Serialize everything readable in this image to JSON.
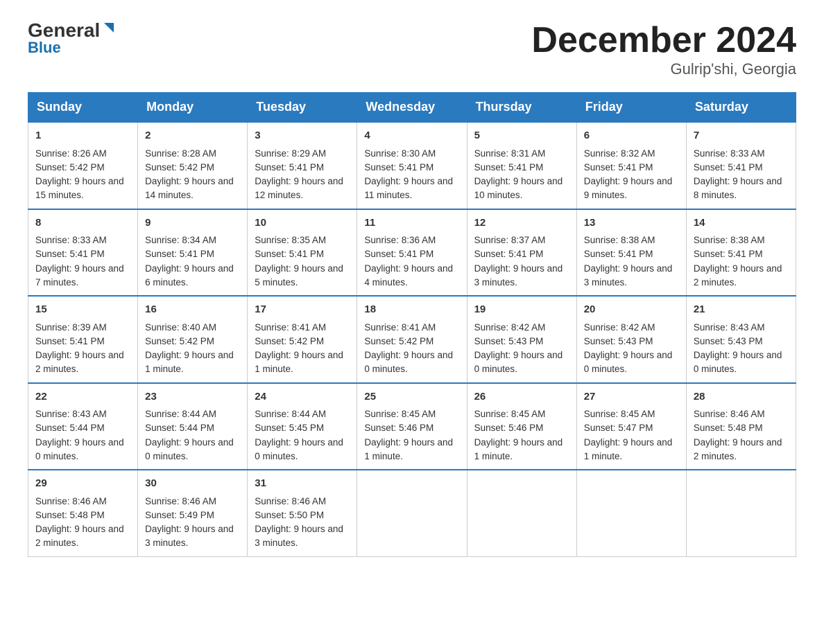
{
  "logo": {
    "general": "General",
    "blue": "Blue"
  },
  "title": "December 2024",
  "location": "Gulrip'shi, Georgia",
  "days_of_week": [
    "Sunday",
    "Monday",
    "Tuesday",
    "Wednesday",
    "Thursday",
    "Friday",
    "Saturday"
  ],
  "weeks": [
    [
      {
        "day": "1",
        "sunrise": "8:26 AM",
        "sunset": "5:42 PM",
        "daylight": "9 hours and 15 minutes."
      },
      {
        "day": "2",
        "sunrise": "8:28 AM",
        "sunset": "5:42 PM",
        "daylight": "9 hours and 14 minutes."
      },
      {
        "day": "3",
        "sunrise": "8:29 AM",
        "sunset": "5:41 PM",
        "daylight": "9 hours and 12 minutes."
      },
      {
        "day": "4",
        "sunrise": "8:30 AM",
        "sunset": "5:41 PM",
        "daylight": "9 hours and 11 minutes."
      },
      {
        "day": "5",
        "sunrise": "8:31 AM",
        "sunset": "5:41 PM",
        "daylight": "9 hours and 10 minutes."
      },
      {
        "day": "6",
        "sunrise": "8:32 AM",
        "sunset": "5:41 PM",
        "daylight": "9 hours and 9 minutes."
      },
      {
        "day": "7",
        "sunrise": "8:33 AM",
        "sunset": "5:41 PM",
        "daylight": "9 hours and 8 minutes."
      }
    ],
    [
      {
        "day": "8",
        "sunrise": "8:33 AM",
        "sunset": "5:41 PM",
        "daylight": "9 hours and 7 minutes."
      },
      {
        "day": "9",
        "sunrise": "8:34 AM",
        "sunset": "5:41 PM",
        "daylight": "9 hours and 6 minutes."
      },
      {
        "day": "10",
        "sunrise": "8:35 AM",
        "sunset": "5:41 PM",
        "daylight": "9 hours and 5 minutes."
      },
      {
        "day": "11",
        "sunrise": "8:36 AM",
        "sunset": "5:41 PM",
        "daylight": "9 hours and 4 minutes."
      },
      {
        "day": "12",
        "sunrise": "8:37 AM",
        "sunset": "5:41 PM",
        "daylight": "9 hours and 3 minutes."
      },
      {
        "day": "13",
        "sunrise": "8:38 AM",
        "sunset": "5:41 PM",
        "daylight": "9 hours and 3 minutes."
      },
      {
        "day": "14",
        "sunrise": "8:38 AM",
        "sunset": "5:41 PM",
        "daylight": "9 hours and 2 minutes."
      }
    ],
    [
      {
        "day": "15",
        "sunrise": "8:39 AM",
        "sunset": "5:41 PM",
        "daylight": "9 hours and 2 minutes."
      },
      {
        "day": "16",
        "sunrise": "8:40 AM",
        "sunset": "5:42 PM",
        "daylight": "9 hours and 1 minute."
      },
      {
        "day": "17",
        "sunrise": "8:41 AM",
        "sunset": "5:42 PM",
        "daylight": "9 hours and 1 minute."
      },
      {
        "day": "18",
        "sunrise": "8:41 AM",
        "sunset": "5:42 PM",
        "daylight": "9 hours and 0 minutes."
      },
      {
        "day": "19",
        "sunrise": "8:42 AM",
        "sunset": "5:43 PM",
        "daylight": "9 hours and 0 minutes."
      },
      {
        "day": "20",
        "sunrise": "8:42 AM",
        "sunset": "5:43 PM",
        "daylight": "9 hours and 0 minutes."
      },
      {
        "day": "21",
        "sunrise": "8:43 AM",
        "sunset": "5:43 PM",
        "daylight": "9 hours and 0 minutes."
      }
    ],
    [
      {
        "day": "22",
        "sunrise": "8:43 AM",
        "sunset": "5:44 PM",
        "daylight": "9 hours and 0 minutes."
      },
      {
        "day": "23",
        "sunrise": "8:44 AM",
        "sunset": "5:44 PM",
        "daylight": "9 hours and 0 minutes."
      },
      {
        "day": "24",
        "sunrise": "8:44 AM",
        "sunset": "5:45 PM",
        "daylight": "9 hours and 0 minutes."
      },
      {
        "day": "25",
        "sunrise": "8:45 AM",
        "sunset": "5:46 PM",
        "daylight": "9 hours and 1 minute."
      },
      {
        "day": "26",
        "sunrise": "8:45 AM",
        "sunset": "5:46 PM",
        "daylight": "9 hours and 1 minute."
      },
      {
        "day": "27",
        "sunrise": "8:45 AM",
        "sunset": "5:47 PM",
        "daylight": "9 hours and 1 minute."
      },
      {
        "day": "28",
        "sunrise": "8:46 AM",
        "sunset": "5:48 PM",
        "daylight": "9 hours and 2 minutes."
      }
    ],
    [
      {
        "day": "29",
        "sunrise": "8:46 AM",
        "sunset": "5:48 PM",
        "daylight": "9 hours and 2 minutes."
      },
      {
        "day": "30",
        "sunrise": "8:46 AM",
        "sunset": "5:49 PM",
        "daylight": "9 hours and 3 minutes."
      },
      {
        "day": "31",
        "sunrise": "8:46 AM",
        "sunset": "5:50 PM",
        "daylight": "9 hours and 3 minutes."
      },
      null,
      null,
      null,
      null
    ]
  ]
}
